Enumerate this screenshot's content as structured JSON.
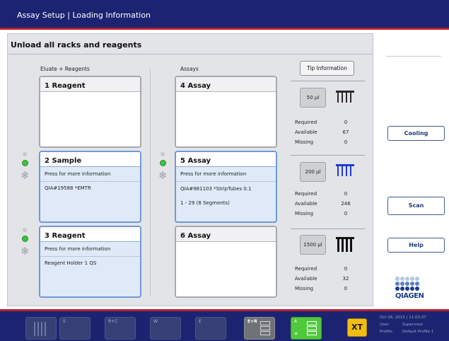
{
  "window": {
    "title": "Assay Setup | Loading Information"
  },
  "main": {
    "heading": "Unload all racks and reagents",
    "col_left_label": "Eluate + Reagents",
    "col_mid_label": "Assays",
    "slot1": {
      "title": "1   Reagent"
    },
    "slot2": {
      "title": "2   Sample",
      "info": "Press for more information",
      "detail": "QIA#19588 *EMTR"
    },
    "slot3": {
      "title": "3   Reagent",
      "info": "Press for more information",
      "detail": "Reagent Holder 1 QS"
    },
    "slot4": {
      "title": "4   Assay"
    },
    "slot5": {
      "title": "5   Assay",
      "info": "Press for more information",
      "detail": "QIA#981103 *StripTubes 0.1",
      "detail2": "1 - 29 (8 Segments)"
    },
    "slot6": {
      "title": "6   Assay"
    }
  },
  "tips": {
    "button": "Tip Information",
    "stat_labels": {
      "required": "Required",
      "available": "Available",
      "missing": "Missing"
    },
    "items": [
      {
        "volume": "50 µl",
        "required": "0",
        "available": "67",
        "missing": "0",
        "icon_color": "#2a2a2a"
      },
      {
        "volume": "200 µl",
        "required": "0",
        "available": "246",
        "missing": "0",
        "icon_color": "#1e3ad6"
      },
      {
        "volume": "1500 µl",
        "required": "0",
        "available": "32",
        "missing": "0",
        "icon_color": "#111111"
      }
    ]
  },
  "side": {
    "cooling": "Cooling",
    "scan": "Scan",
    "help": "Help",
    "logo": "QIAGEN"
  },
  "bottom": {
    "slots": [
      "S",
      "R+C",
      "W",
      "E",
      "E+R",
      "A"
    ],
    "xt": "XT",
    "status": {
      "date": "Oct 26, 2015 | 11:03:37",
      "user_label": "User:",
      "user": "Supervisor",
      "profile_label": "Profile:",
      "profile": "Default Profile 1"
    }
  },
  "colors": {
    "header": "#1c2472",
    "accent_red": "#b32034",
    "selected_border": "#6f9ad6",
    "selected_fill": "#dfe9f7",
    "green_status": "#3ec33e",
    "logo_blue": "#1b3c89"
  }
}
